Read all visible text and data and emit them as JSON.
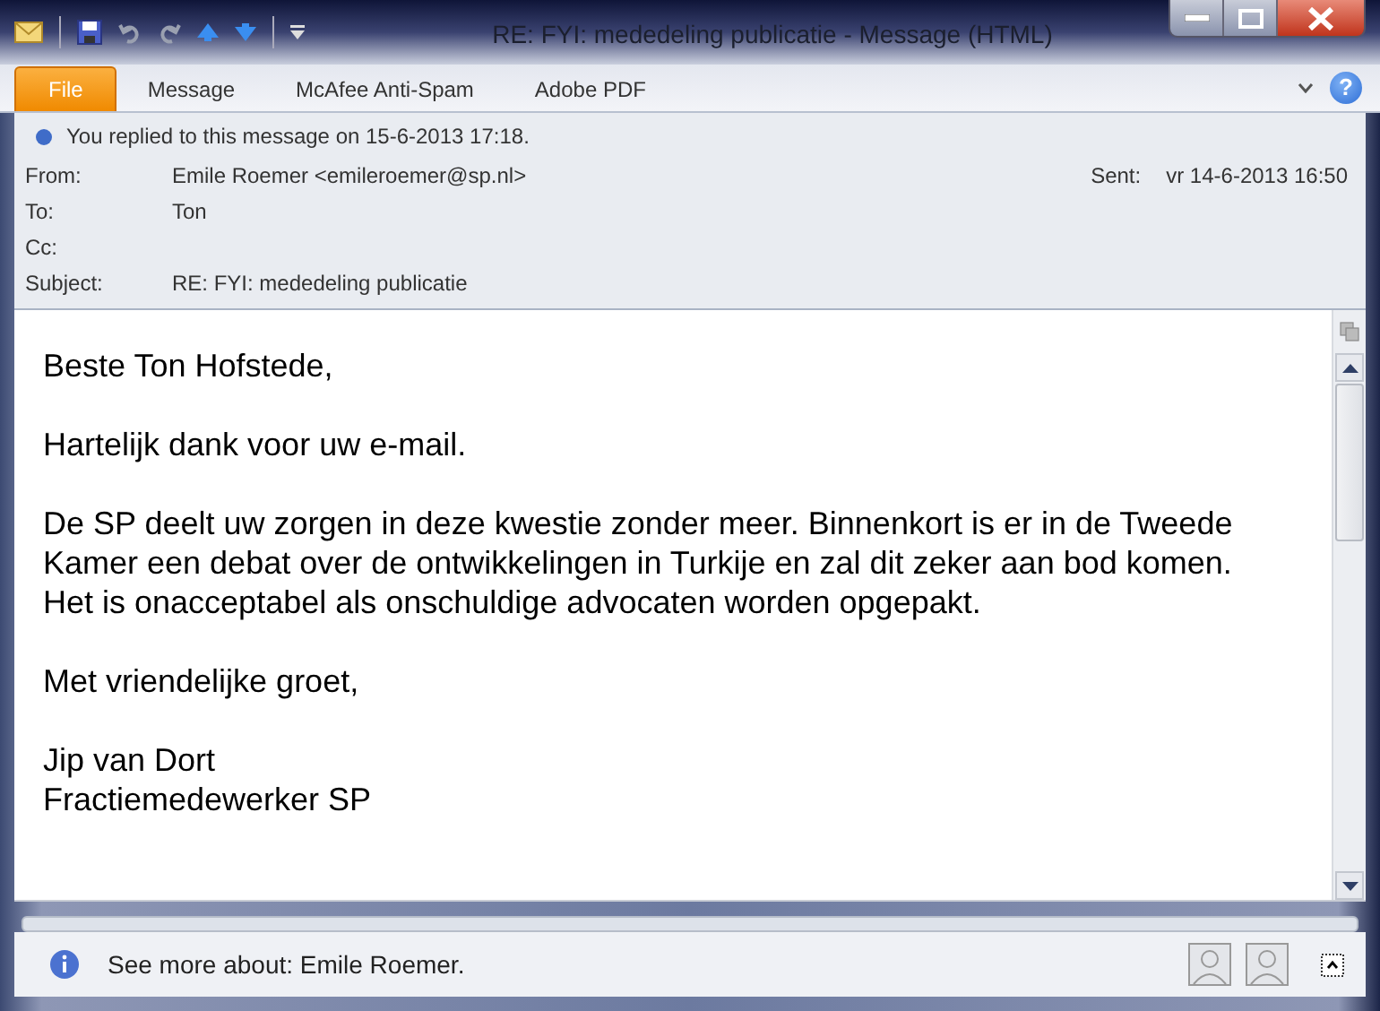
{
  "window": {
    "title": "RE: FYI: mededeling publicatie  -  Message (HTML)"
  },
  "tabs": [
    {
      "label": "File",
      "selected": true
    },
    {
      "label": "Message",
      "selected": false
    },
    {
      "label": "McAfee Anti-Spam",
      "selected": false
    },
    {
      "label": "Adobe PDF",
      "selected": false
    }
  ],
  "help": {
    "label": "?"
  },
  "info_bar": {
    "text": "You replied to this message on 15-6-2013 17:18."
  },
  "headers": [
    {
      "label": "From:",
      "value": "Emile Roemer <emileroemer@sp.nl>"
    },
    {
      "label": "To:",
      "value": "Ton"
    },
    {
      "label": "Cc:"
    },
    {
      "label": "Subject:",
      "value": "RE: FYI: mededeling publicatie"
    }
  ],
  "sent": {
    "label": "Sent:",
    "value": "vr 14-6-2013 16:50"
  },
  "body": {
    "paragraphs": [
      [
        "Beste Ton Hofstede,"
      ],
      [
        "Hartelijk dank voor uw e-mail."
      ],
      [
        "De SP deelt uw zorgen in deze kwestie zonder meer. Binnenkort is er in de Tweede Kamer een debat over de ontwikkelingen in Turkije en zal dit zeker aan bod komen. Het is onacceptabel als onschuldige advocaten worden opgepakt."
      ],
      [
        "Met vriendelijke groet,"
      ],
      [
        "Jip van Dort",
        "Fractiemedewerker SP"
      ]
    ]
  },
  "people_pane": {
    "text": "See more about: Emile Roemer."
  }
}
